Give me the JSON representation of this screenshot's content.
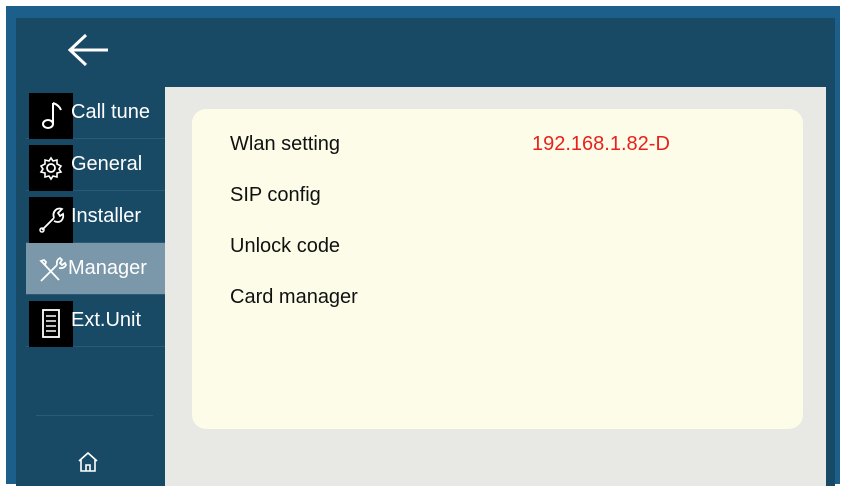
{
  "header": {
    "back_icon": "arrow-left-icon"
  },
  "sidebar": {
    "items": [
      {
        "label": "Call tune",
        "icon": "music-note-icon"
      },
      {
        "label": "General",
        "icon": "gear-icon"
      },
      {
        "label": "Installer",
        "icon": "wrench-icon"
      },
      {
        "label": "Manager",
        "icon": "tools-icon",
        "active": true
      },
      {
        "label": "Ext.Unit",
        "icon": "document-icon"
      }
    ],
    "home_icon": "home-icon"
  },
  "main": {
    "rows": [
      {
        "label": "Wlan setting",
        "value": "192.168.1.82-D"
      },
      {
        "label": "SIP config"
      },
      {
        "label": "Unlock code"
      },
      {
        "label": "Card manager"
      }
    ]
  },
  "colors": {
    "topbar": "#184a66",
    "sidebar_active": "#7a98aa",
    "content_bg": "#e8e8e4",
    "card_bg": "#fcfce9",
    "value_text": "#e8211f"
  }
}
